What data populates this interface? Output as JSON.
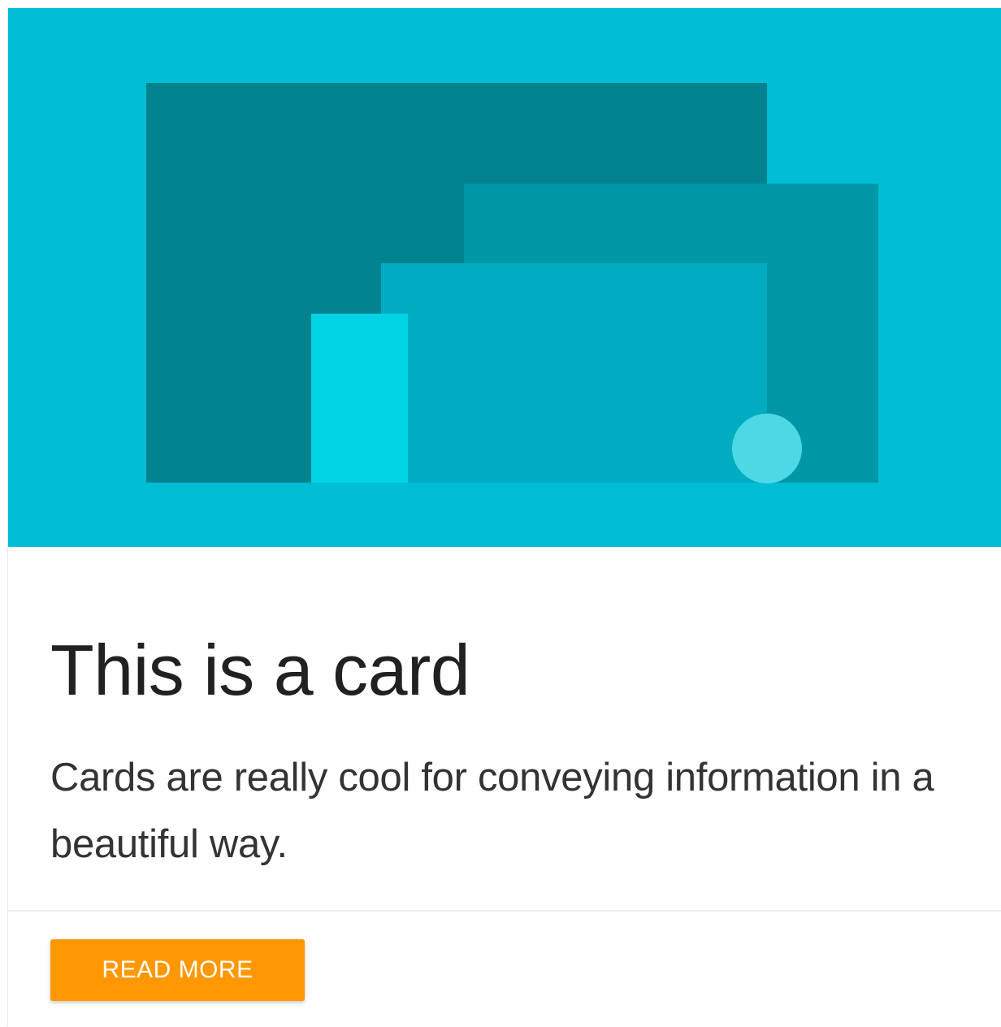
{
  "card": {
    "title": "This is a card",
    "text": "Cards are really cool for conveying information in a beautiful way.",
    "action_label": "READ MORE"
  },
  "colors": {
    "media_background": "#00bcd4",
    "panel_back": "#00838f",
    "panel_middle": "#0097a7",
    "panel_front": "#00acc1",
    "accent_rect": "#00d4e4",
    "accent_circle": "#4dd8e6",
    "button": "#ff9800"
  }
}
